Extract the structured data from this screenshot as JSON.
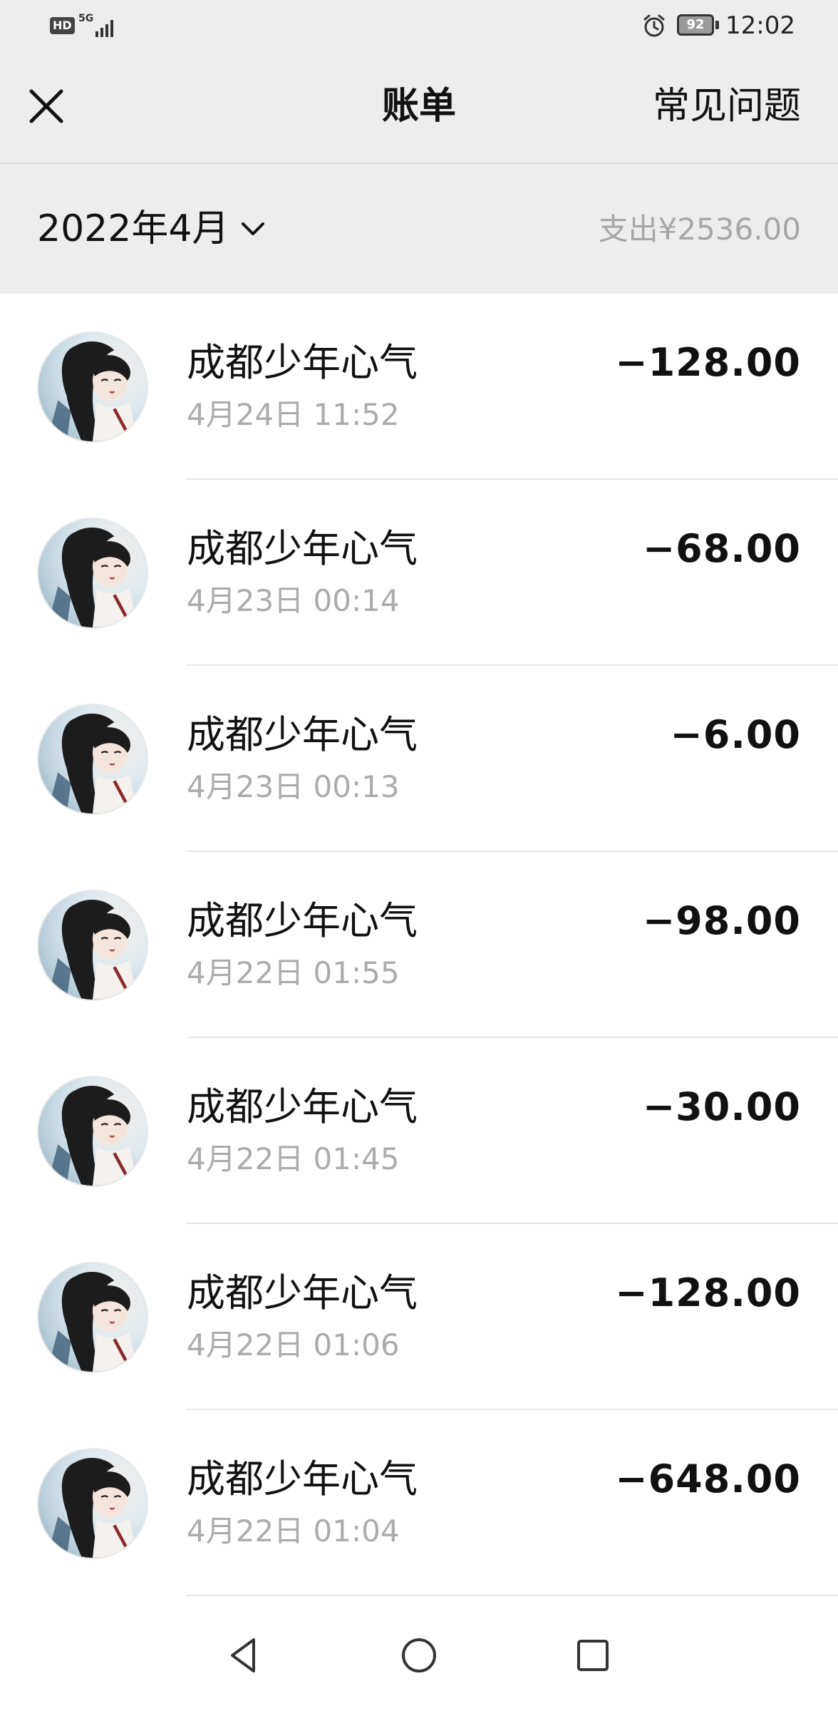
{
  "status_bar": {
    "hd": "HD",
    "network": "5G",
    "battery": "92",
    "time": "12:02",
    "icons": [
      "hd-badge",
      "signal-icon",
      "alarm-icon",
      "battery-icon"
    ]
  },
  "header": {
    "close_icon": "close-icon",
    "title": "账单",
    "faq_label": "常见问题"
  },
  "filter": {
    "month_label": "2022年4月",
    "chevron_icon": "chevron-down-icon",
    "expense_summary": "支出¥2536.00"
  },
  "transactions": [
    {
      "merchant": "成都少年心气",
      "time": "4月24日 11:52",
      "amount": "−128.00"
    },
    {
      "merchant": "成都少年心气",
      "time": "4月23日 00:14",
      "amount": "−68.00"
    },
    {
      "merchant": "成都少年心气",
      "time": "4月23日 00:13",
      "amount": "−6.00"
    },
    {
      "merchant": "成都少年心气",
      "time": "4月22日 01:55",
      "amount": "−98.00"
    },
    {
      "merchant": "成都少年心气",
      "time": "4月22日 01:45",
      "amount": "−30.00"
    },
    {
      "merchant": "成都少年心气",
      "time": "4月22日 01:06",
      "amount": "−128.00"
    },
    {
      "merchant": "成都少年心气",
      "time": "4月22日 01:04",
      "amount": "−648.00"
    }
  ],
  "system_nav": {
    "icons": [
      "back-icon",
      "home-icon",
      "recents-icon"
    ]
  },
  "colors": {
    "header_bg": "#ededed",
    "list_bg": "#ffffff",
    "secondary_text": "#ababab",
    "divider": "#e6e6e6"
  }
}
